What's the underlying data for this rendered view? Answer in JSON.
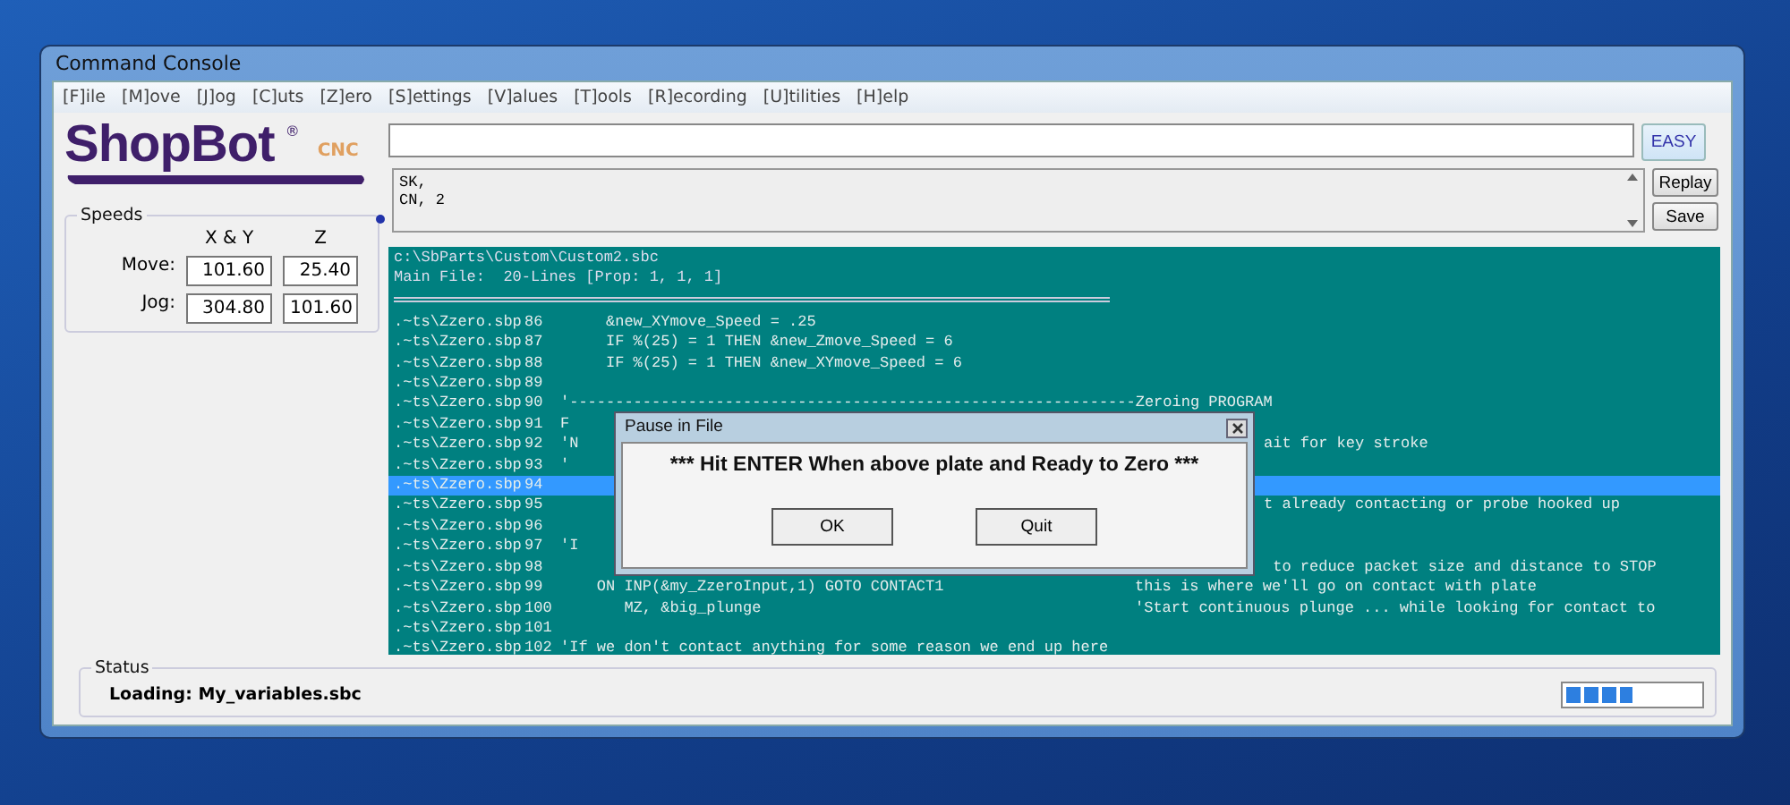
{
  "window": {
    "title": "Command Console"
  },
  "menu": [
    "[F]ile",
    "[M]ove",
    "[J]og",
    "[C]uts",
    "[Z]ero",
    "[S]ettings",
    "[V]alues",
    "[T]ools",
    "[R]ecording",
    "[U]tilities",
    "[H]elp"
  ],
  "logo": {
    "name": "ShopBot",
    "mark": "®",
    "suffix": "CNC"
  },
  "speeds": {
    "title": "Speeds",
    "columns": [
      "X & Y",
      "Z"
    ],
    "rows": [
      {
        "label": "Move:",
        "values": [
          "101.60",
          "25.40"
        ]
      },
      {
        "label": "Jog:",
        "values": [
          "304.80",
          "101.60"
        ]
      }
    ]
  },
  "command": {
    "easy_button": "EASY",
    "history": [
      "SK,",
      "CN, 2"
    ],
    "buttons": [
      "Replay",
      "Save"
    ]
  },
  "console": {
    "header": [
      "c:\\SbParts\\Custom\\Custom2.sbc",
      "Main File:  20-Lines [Prop: 1, 1, 1]"
    ],
    "lines": [
      {
        "file": ".~ts\\Zzero.sbp",
        "num": "86",
        "code": "     &new_XYmove_Speed = .25",
        "selected": false
      },
      {
        "file": ".~ts\\Zzero.sbp",
        "num": "87",
        "code": "     IF %(25) = 1 THEN &new_Zmove_Speed = 6",
        "selected": false
      },
      {
        "file": ".~ts\\Zzero.sbp",
        "num": "88",
        "code": "     IF %(25) = 1 THEN &new_XYmove_Speed = 6",
        "selected": false
      },
      {
        "file": ".~ts\\Zzero.sbp",
        "num": "89",
        "selected": false
      },
      {
        "file": ".~ts\\Zzero.sbp",
        "num": "90",
        "code": "'--------------------------------------------------------------Zeroing PROGRAM",
        "selected": false
      },
      {
        "file": ".~ts\\Zzero.sbp",
        "num": "91",
        "code": "F",
        "selected": false
      },
      {
        "file": ".~ts\\Zzero.sbp",
        "num": "92",
        "code": "'N",
        "tail": "ait for key stroke",
        "selected": false
      },
      {
        "file": ".~ts\\Zzero.sbp",
        "num": "93",
        "code": "'",
        "selected": false
      },
      {
        "file": ".~ts\\Zzero.sbp",
        "num": "94",
        "selected": true
      },
      {
        "file": ".~ts\\Zzero.sbp",
        "num": "95",
        "tail": "t already contacting or probe hooked up",
        "selected": false
      },
      {
        "file": ".~ts\\Zzero.sbp",
        "num": "96",
        "selected": false
      },
      {
        "file": ".~ts\\Zzero.sbp",
        "num": "97",
        "code": "'I",
        "selected": false
      },
      {
        "file": ".~ts\\Zzero.sbp",
        "num": "98",
        "tail": " to reduce packet size and distance to STOP",
        "selected": false
      },
      {
        "file": ".~ts\\Zzero.sbp",
        "num": "99",
        "code": "    ON INP(&my_ZzeroInput,1) GOTO CONTACT1",
        "comment": "this is where we'll go on contact with plate",
        "selected": false
      },
      {
        "file": ".~ts\\Zzero.sbp",
        "num": "100",
        "code": "       MZ, &big_plunge",
        "comment": "'Start continuous plunge ... while looking for contact to",
        "selected": false
      },
      {
        "file": ".~ts\\Zzero.sbp",
        "num": "101",
        "selected": false
      },
      {
        "file": ".~ts\\Zzero.sbp",
        "num": "102",
        "code": "'If we don't contact anything for some reason we end up here",
        "selected": false
      }
    ]
  },
  "dialog": {
    "title": "Pause in File",
    "message": "*** Hit ENTER When above plate and Ready to Zero ***",
    "buttons": [
      "OK",
      "Quit"
    ]
  },
  "status": {
    "title": "Status",
    "text": "Loading: My_variables.sbc",
    "level": 0.5
  }
}
